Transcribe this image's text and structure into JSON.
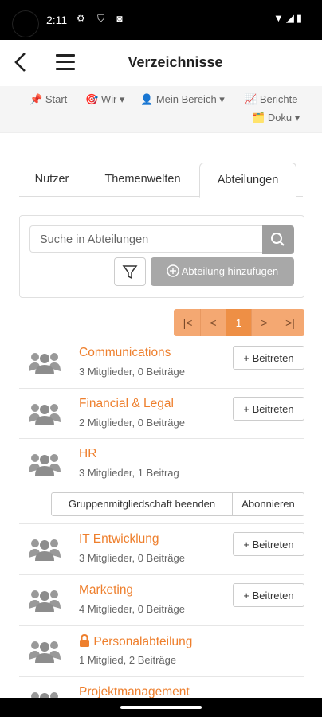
{
  "status": {
    "time": "2:11",
    "left_icons": "⚙ ⛉ ◙",
    "right_icons": "▼◢▮"
  },
  "appbar": {
    "title": "Verzeichnisse",
    "back_icon": "arrow-left-icon",
    "menu_icon": "hamburger-menu-icon"
  },
  "topnav": {
    "items": [
      {
        "icon": "📌",
        "label": "Start"
      },
      {
        "icon": "🎯",
        "label": "Wir ▾"
      },
      {
        "icon": "👤",
        "label": "Mein Bereich ▾"
      },
      {
        "icon": "📈",
        "label": "Berichte"
      },
      {
        "icon": "🗂️",
        "label": "Doku ▾"
      }
    ]
  },
  "tabs": [
    {
      "label": "Nutzer"
    },
    {
      "label": "Themenwelten"
    },
    {
      "label": "Abteilungen"
    }
  ],
  "search": {
    "placeholder": "Suche in Abteilungen",
    "add_label": "Abteilung hinzufügen"
  },
  "pager": {
    "first": "|<",
    "prev": "<",
    "current": "1",
    "next": ">",
    "last": ">|"
  },
  "join_label": "Beitreten",
  "departments": [
    {
      "name": "Communications",
      "meta": "3 Mitglieder, 0 Beiträge",
      "join": true,
      "locked": false
    },
    {
      "name": "Financial & Legal",
      "meta": "2 Mitglieder, 0 Beiträge",
      "join": true,
      "locked": false
    },
    {
      "name": "HR",
      "meta": "3 Mitglieder, 1 Beitrag",
      "join": false,
      "locked": false
    },
    {
      "name": "IT Entwicklung",
      "meta": "3 Mitglieder, 0 Beiträge",
      "join": true,
      "locked": false
    },
    {
      "name": "Marketing",
      "meta": "4 Mitglieder, 0 Beiträge",
      "join": true,
      "locked": false
    },
    {
      "name": "Personalabteilung",
      "meta": "1 Mitglied, 2 Beiträge",
      "join": false,
      "locked": true
    },
    {
      "name": "Projektmanagement",
      "meta": "",
      "join": false,
      "locked": false
    }
  ],
  "hr_actions": {
    "leave": "Gruppenmitgliedschaft beenden",
    "subscribe": "Abonnieren"
  },
  "colors": {
    "accent": "#ee7f2d",
    "pager": "#f4a872",
    "pager_active": "#ee8f45"
  }
}
